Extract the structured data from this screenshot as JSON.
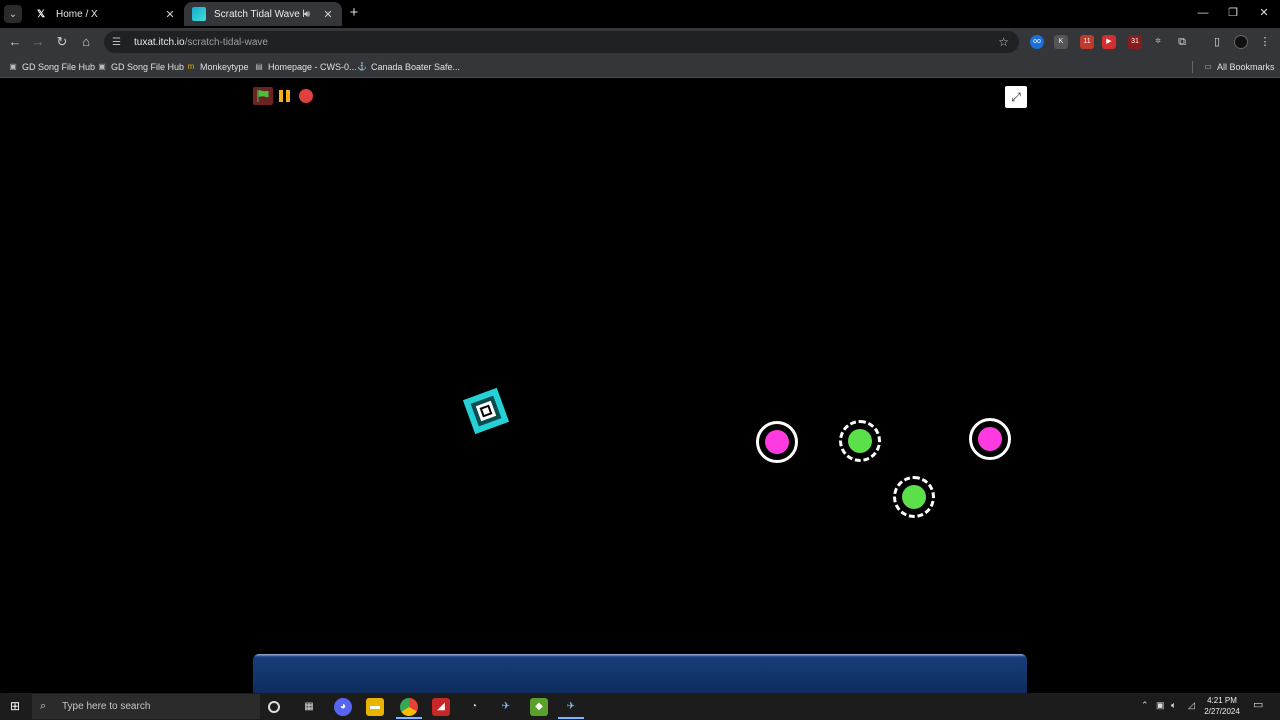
{
  "browser": {
    "tabs": [
      {
        "title": "Home / X",
        "active": false,
        "favicon": "x-logo-icon"
      },
      {
        "title": "Scratch Tidal Wave by SuJ",
        "active": true,
        "favicon": "scratch-game-icon"
      }
    ],
    "address": {
      "host": "tuxat.itch.io",
      "path": "/scratch-tidal-wave"
    },
    "bookmarks": [
      "GD Song File Hub",
      "GD Song File Hub",
      "Monkeytype",
      "Homepage - CWS-0...",
      "Canada Boater Safe..."
    ],
    "all_bookmarks_label": "All Bookmarks",
    "extension_badges": {
      "ext3": "11",
      "ext6": "31"
    }
  },
  "game": {
    "orbs": [
      {
        "color": "pink",
        "style": "solid"
      },
      {
        "color": "green",
        "style": "dashed"
      },
      {
        "color": "pink",
        "style": "solid"
      },
      {
        "color": "green",
        "style": "dashed"
      }
    ]
  },
  "taskbar": {
    "search_placeholder": "Type here to search",
    "time": "4:21 PM",
    "date": "2/27/2024"
  },
  "colors": {
    "player": "#24d1d6",
    "orb_pink": "#ff3ae0",
    "orb_green": "#5ce04a",
    "stop_button": "#e0413c",
    "pause_button": "#f2b01e"
  }
}
